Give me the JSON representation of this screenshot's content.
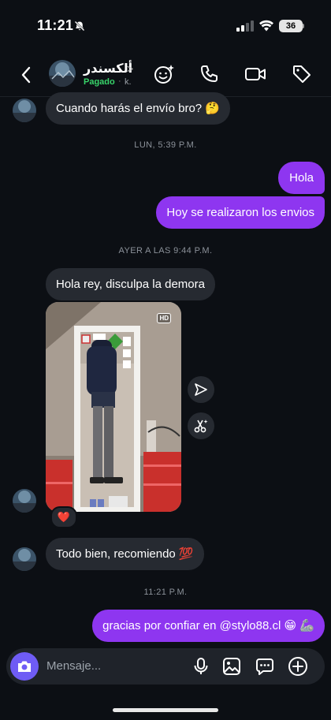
{
  "status_bar": {
    "time": "11:21",
    "battery": "36"
  },
  "header": {
    "contact_name": "ألكسندر",
    "chevron": ">",
    "status_label": "Pagado",
    "status_dot": "·",
    "status_more": "k."
  },
  "messages": [
    {
      "side": "in",
      "text": "Cuando harás el envío bro? 🤔"
    },
    {
      "timestamp": "LUN, 5:39 P.M."
    },
    {
      "side": "out",
      "text": "Hola"
    },
    {
      "side": "out",
      "text": "Hoy se realizaron los envios"
    },
    {
      "timestamp": "AYER A LAS 9:44 P.M."
    },
    {
      "side": "in",
      "text": "Hola rey, disculpa la demora"
    },
    {
      "side": "in",
      "type": "photo",
      "badge": "HD",
      "reaction": "❤️"
    },
    {
      "side": "in",
      "text": "Todo bien, recomiendo 💯"
    },
    {
      "timestamp": "11:21 P.M."
    },
    {
      "side": "out",
      "text": "gracias por confiar en @stylo88.cl 😁 🦾"
    }
  ],
  "input": {
    "placeholder": "Mensaje..."
  },
  "colors": {
    "background": "#0c0f14",
    "incoming": "#262a31",
    "outgoing": "#8e36f0",
    "camera": "#6f5cf5",
    "paid": "#38d46a"
  }
}
